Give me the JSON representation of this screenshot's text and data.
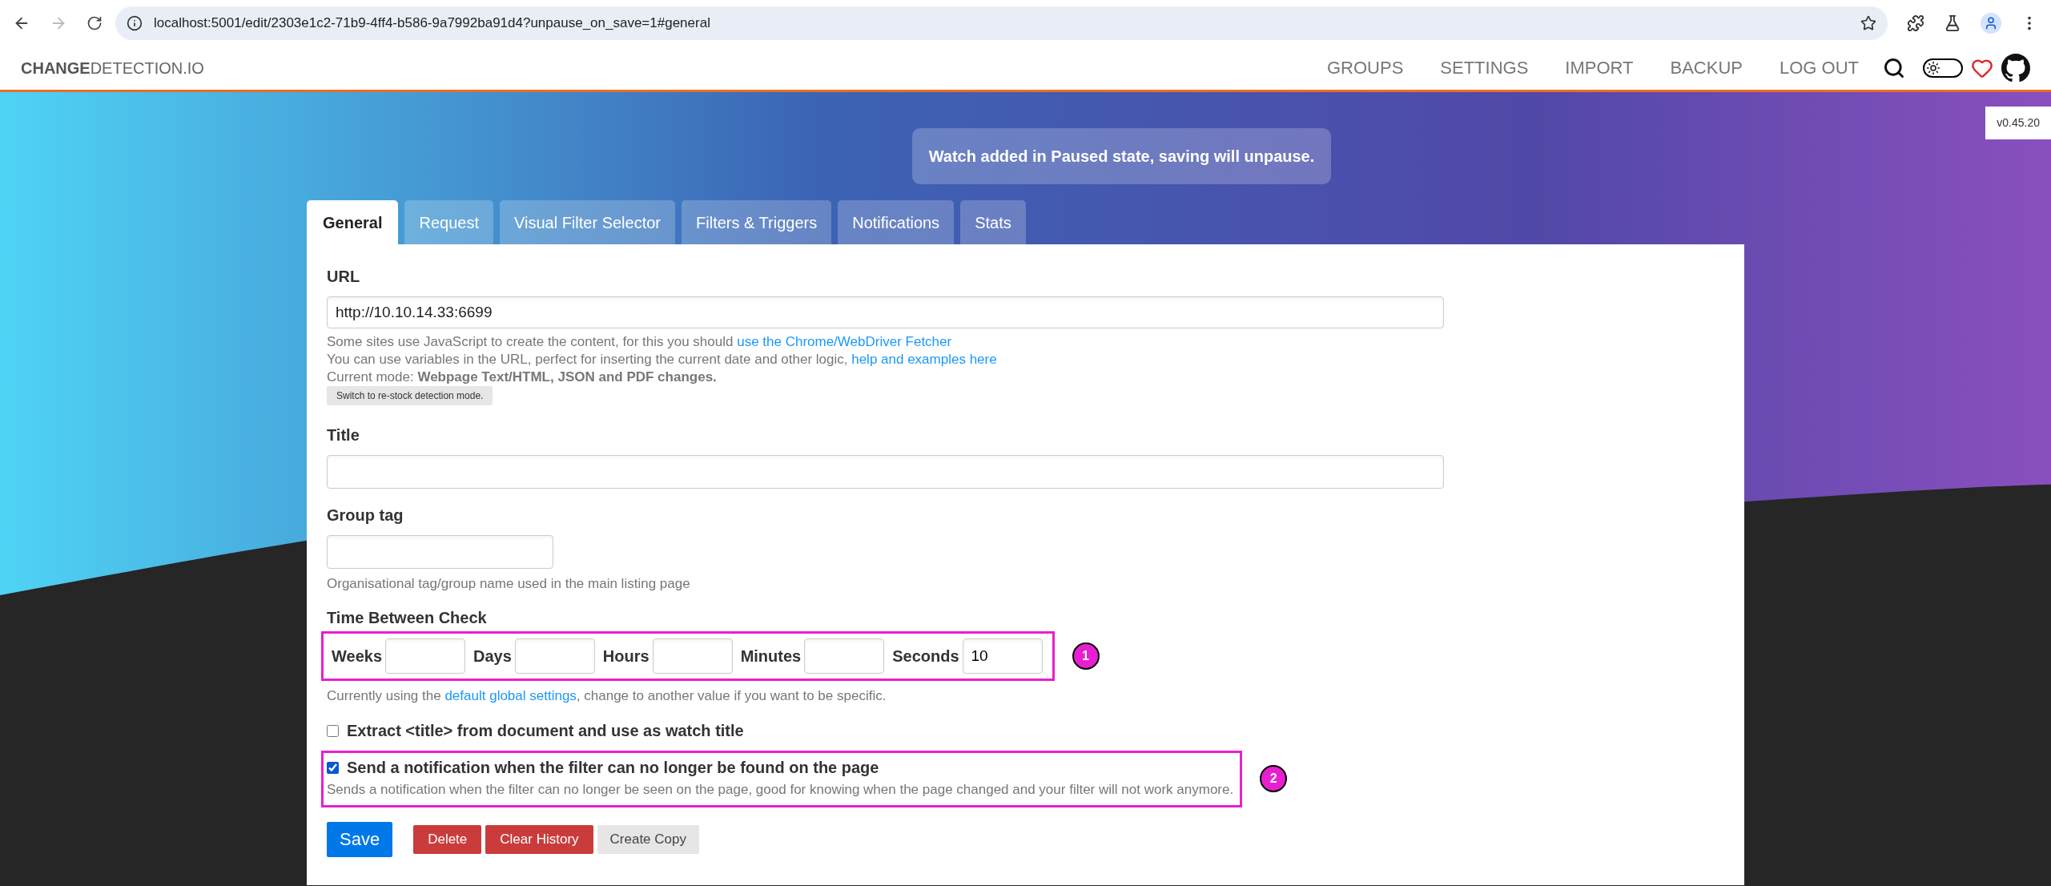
{
  "browser": {
    "url": "localhost:5001/edit/2303e1c2-71b9-4ff4-b586-9a7992ba91d4?unpause_on_save=1#general"
  },
  "header": {
    "logo_bold": "CHANGE",
    "logo_rest": "DETECTION.IO",
    "nav": [
      "GROUPS",
      "SETTINGS",
      "IMPORT",
      "BACKUP",
      "LOG OUT"
    ]
  },
  "theme_toggle": {
    "on": false
  },
  "version": "v0.45.20",
  "notice": "Watch added in Paused state, saving will unpause.",
  "tabs": [
    {
      "label": "General",
      "selected": true
    },
    {
      "label": "Request",
      "selected": false
    },
    {
      "label": "Visual Filter Selector",
      "selected": false
    },
    {
      "label": "Filters & Triggers",
      "selected": false
    },
    {
      "label": "Notifications",
      "selected": false
    },
    {
      "label": "Stats",
      "selected": false
    }
  ],
  "url_field": {
    "label": "URL",
    "value": "http://10.10.14.33:6699",
    "help": [
      {
        "text": "Some sites use JavaScript to create the content, for this you should ",
        "link": "use the Chrome/WebDriver Fetcher"
      },
      {
        "text": "You can use variables in the URL, perfect for inserting the current date and other logic, ",
        "link": "help and examples here"
      },
      {
        "text": "Current mode: **Webpage Text/HTML, JSON and PDF changes.**"
      }
    ],
    "mode_button": "Switch to re-stock detection mode."
  },
  "title_field": {
    "label": "Title"
  },
  "group_tag": {
    "label": "Group tag",
    "help": "Organisational tag/group name used in the main listing page"
  },
  "time_between_check": {
    "label": "Time Between Check",
    "annotation": "1",
    "fields": [
      {
        "label": "Weeks"
      },
      {
        "label": "Days"
      },
      {
        "label": "Hours"
      },
      {
        "label": "Minutes"
      },
      {
        "label": "Seconds",
        "value": "10"
      }
    ],
    "help": {
      "before": "Currently using the ",
      "link": "default global settings",
      "after": ", change to another value if you want to be specific."
    }
  },
  "options": [
    {
      "label": "Extract <title> from document and use as watch title",
      "checked": false
    },
    {
      "label": "Send a notification when the filter can no longer be found on the page",
      "checked": true,
      "help": "Sends a notification when the filter can no longer be seen on the page, good for knowing when the page changed and your filter will not work anymore.",
      "annotation": "2"
    }
  ],
  "buttons": [
    {
      "label": "Save",
      "kind": "primary"
    },
    {
      "label": "Delete",
      "kind": "danger"
    },
    {
      "label": "Clear History",
      "kind": "danger"
    },
    {
      "label": "Create Copy",
      "kind": "secondary"
    }
  ]
}
